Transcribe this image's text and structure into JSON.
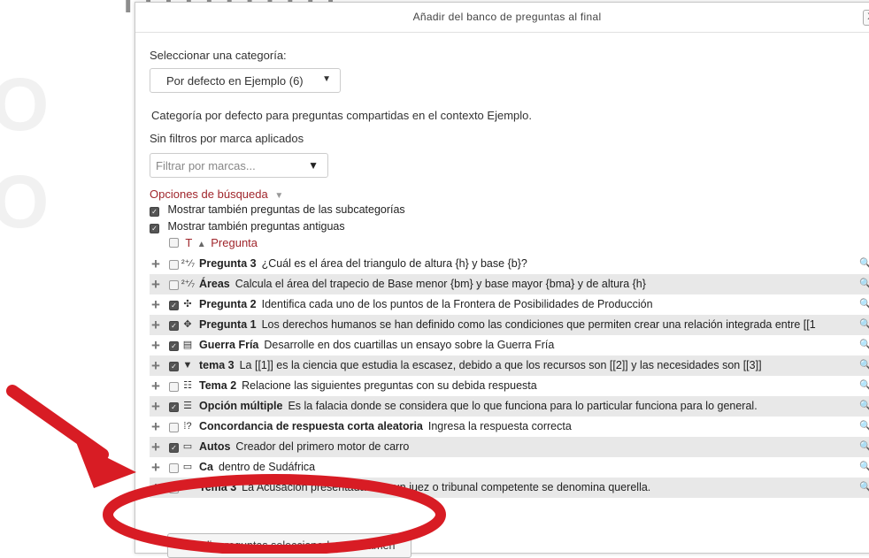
{
  "dialog": {
    "title": "Añadir del banco de preguntas al final",
    "close_label": "X"
  },
  "category": {
    "label": "Seleccionar una categoría:",
    "selected": "Por defecto en Ejemplo (6)",
    "description": "Categoría por defecto para preguntas compartidas en el contexto Ejemplo.",
    "filter_status": "Sin filtros por marca aplicados"
  },
  "tags": {
    "placeholder": "Filtrar por marcas..."
  },
  "search_options": {
    "label": "Opciones de búsqueda",
    "subcategories": "Mostrar también preguntas de las subcategorías",
    "old_questions": "Mostrar también preguntas antiguas"
  },
  "table": {
    "col_type": "T",
    "col_question": "Pregunta"
  },
  "questions": [
    {
      "name": "Pregunta 3",
      "text": "¿Cuál es el área del triangulo de altura {h} y base {b}?",
      "icon": "calculated-icon",
      "checked": false,
      "shade": false
    },
    {
      "name": "Áreas",
      "text": "Calcula el área del trapecio de Base menor {bm} y base mayor {bma} y de altura {h}",
      "icon": "calculated-icon",
      "checked": false,
      "shade": true
    },
    {
      "name": "Pregunta 2",
      "text": "Identifica cada uno de los puntos de la Frontera de Posibilidades de Producción",
      "icon": "drag-drop-markers-icon",
      "checked": true,
      "shade": false
    },
    {
      "name": "Pregunta 1",
      "text": "Los derechos humanos se han definido como las condiciones que permiten crear una relación integrada entre [[1",
      "icon": "drag-drop-image-icon",
      "checked": true,
      "shade": true
    },
    {
      "name": "Guerra Fría",
      "text": "Desarrolle en dos cuartillas un ensayo sobre la Guerra Fría",
      "icon": "essay-icon",
      "checked": true,
      "shade": false
    },
    {
      "name": "tema 3",
      "text": "La [[1]] es la ciencia que estudia la escasez, debido a que los recursos son [[2]] y las necesidades son [[3]]",
      "icon": "select-missing-words-icon",
      "checked": true,
      "shade": true
    },
    {
      "name": "Tema 2",
      "text": "Relacione las siguientes preguntas con su debida respuesta",
      "icon": "matching-icon",
      "checked": false,
      "shade": false
    },
    {
      "name": "Opción múltiple",
      "text": "Es la falacia donde se considera que lo que funciona para lo particular funciona para lo general.",
      "icon": "multichoice-icon",
      "checked": true,
      "shade": true
    },
    {
      "name": "Concordancia de respuesta corta aleatoria",
      "text": "Ingresa la respuesta correcta",
      "icon": "random-match-icon",
      "checked": false,
      "shade": false
    },
    {
      "name": "Autos",
      "text": "Creador del primero motor de carro",
      "icon": "short-answer-icon",
      "checked": true,
      "shade": true
    },
    {
      "name": "Ca",
      "text": "dentro de Sudáfrica",
      "icon": "short-answer-icon",
      "checked": false,
      "shade": false
    },
    {
      "name": "Tema 3",
      "text": "La Acusación presentada ante un juez o tribunal competente se denomina querella.",
      "icon": "true-false-icon",
      "checked": false,
      "shade": true
    }
  ],
  "actions": {
    "add_selected": "Añadir preguntas seleccionadas al examen"
  },
  "colors": {
    "accent_link": "#a0262c",
    "annotation": "#d81c24"
  }
}
